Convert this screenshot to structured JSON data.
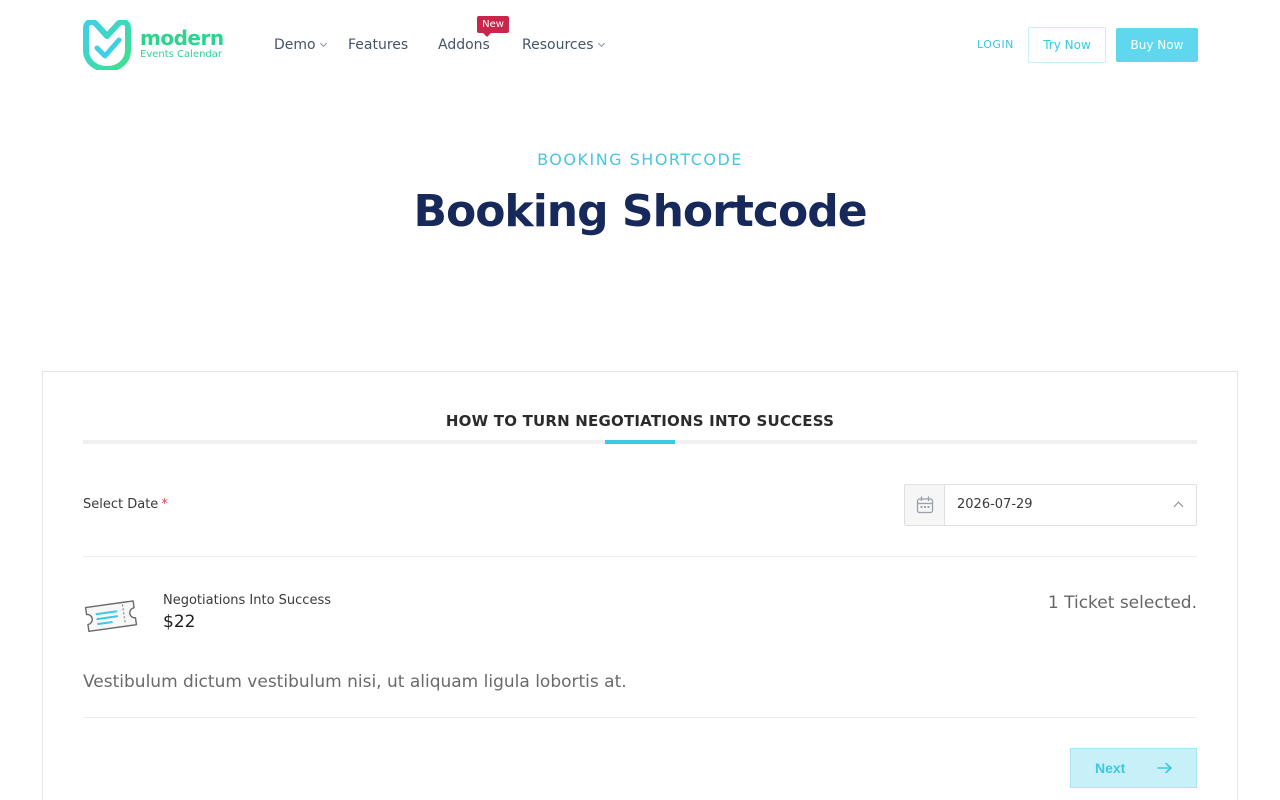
{
  "brand": {
    "name": "modern",
    "sub": "Events Calendar",
    "color": "#2fd38f"
  },
  "nav": {
    "items": [
      {
        "label": "Demo",
        "dropdown": true
      },
      {
        "label": "Features",
        "dropdown": false
      },
      {
        "label": "Addons",
        "dropdown": false,
        "badge": "New"
      },
      {
        "label": "Resources",
        "dropdown": true
      }
    ],
    "login": "LOGIN",
    "try_now": "Try Now",
    "buy_now": "Buy Now"
  },
  "hero": {
    "kicker": "BOOKING SHORTCODE",
    "title": "Booking Shortcode"
  },
  "booking": {
    "event_title": "HOW TO TURN NEGOTIATIONS INTO SUCCESS",
    "date_label": "Select Date",
    "required_mark": "*",
    "date_value": "2026-07-29",
    "ticket": {
      "name": "Negotiations Into Success",
      "price": "$22",
      "selected_text": "1 Ticket selected.",
      "description": "Vestibulum dictum vestibulum nisi, ut aliquam ligula lobortis at."
    },
    "next_label": "Next"
  },
  "colors": {
    "accent": "#3cc9e6",
    "title": "#17295a",
    "badge": "#c8264a",
    "button": "#5fd8ef"
  },
  "icons": [
    "logo-icon",
    "chevron-down-icon",
    "calendar-icon",
    "chevron-up-icon",
    "ticket-icon",
    "arrow-right-icon"
  ]
}
